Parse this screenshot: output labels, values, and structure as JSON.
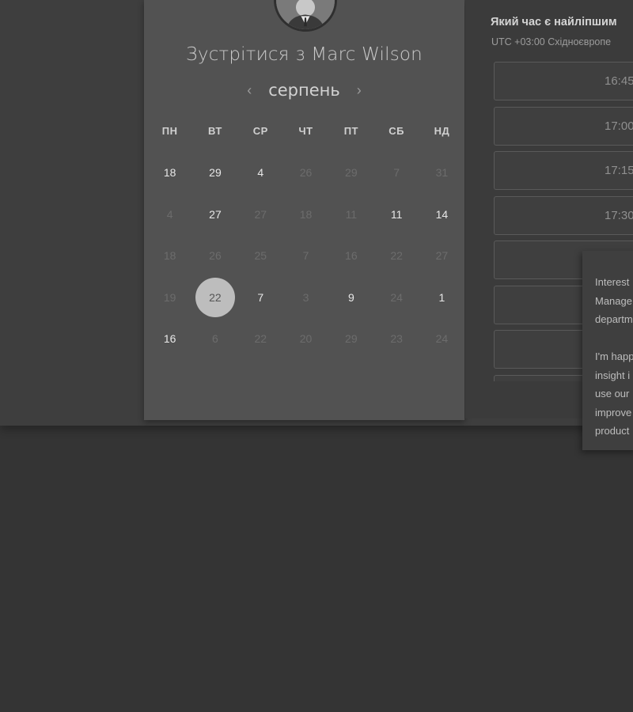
{
  "scheduler": {
    "title": "Зустрітися з Marc Wilson",
    "month": "серпень",
    "prev_icon": "chevron-left-icon",
    "next_icon": "chevron-right-icon",
    "weekdays": [
      "ПН",
      "ВТ",
      "СР",
      "ЧТ",
      "ПТ",
      "СБ",
      "НД"
    ],
    "days": [
      {
        "label": "18",
        "available": true
      },
      {
        "label": "29",
        "available": true
      },
      {
        "label": "4",
        "available": true
      },
      {
        "label": "26",
        "available": false
      },
      {
        "label": "29",
        "available": false
      },
      {
        "label": "7",
        "available": false
      },
      {
        "label": "31",
        "available": false
      },
      {
        "label": "4",
        "available": false
      },
      {
        "label": "27",
        "available": true
      },
      {
        "label": "27",
        "available": false
      },
      {
        "label": "18",
        "available": false
      },
      {
        "label": "11",
        "available": false
      },
      {
        "label": "11",
        "available": true
      },
      {
        "label": "14",
        "available": true
      },
      {
        "label": "18",
        "available": false
      },
      {
        "label": "26",
        "available": false
      },
      {
        "label": "25",
        "available": false
      },
      {
        "label": "7",
        "available": false
      },
      {
        "label": "16",
        "available": false
      },
      {
        "label": "22",
        "available": false
      },
      {
        "label": "27",
        "available": false
      },
      {
        "label": "19",
        "available": false
      },
      {
        "label": "22",
        "available": true,
        "selected": true
      },
      {
        "label": "7",
        "available": true
      },
      {
        "label": "3",
        "available": false
      },
      {
        "label": "9",
        "available": true
      },
      {
        "label": "24",
        "available": false
      },
      {
        "label": "1",
        "available": true
      },
      {
        "label": "16",
        "available": true
      },
      {
        "label": "6",
        "available": false
      },
      {
        "label": "22",
        "available": false
      },
      {
        "label": "20",
        "available": false
      },
      {
        "label": "29",
        "available": false
      },
      {
        "label": "23",
        "available": false
      },
      {
        "label": "24",
        "available": false
      }
    ]
  },
  "times": {
    "question": "Який час є найліпшим",
    "timezone": "UTC +03:00 Східноєвропе",
    "slots": [
      "16:45",
      "17:00",
      "17:15",
      "17:30",
      "",
      "",
      ""
    ]
  },
  "popup": {
    "lines_a": [
      "Interest",
      "Manage",
      "departm"
    ],
    "lines_b": [
      "I'm happ",
      "insight i",
      "use our",
      "improve",
      "product"
    ]
  },
  "colors": {
    "selected_day": "#bdbdbd",
    "page_bg": "#343434",
    "card_bg": "#525252"
  }
}
